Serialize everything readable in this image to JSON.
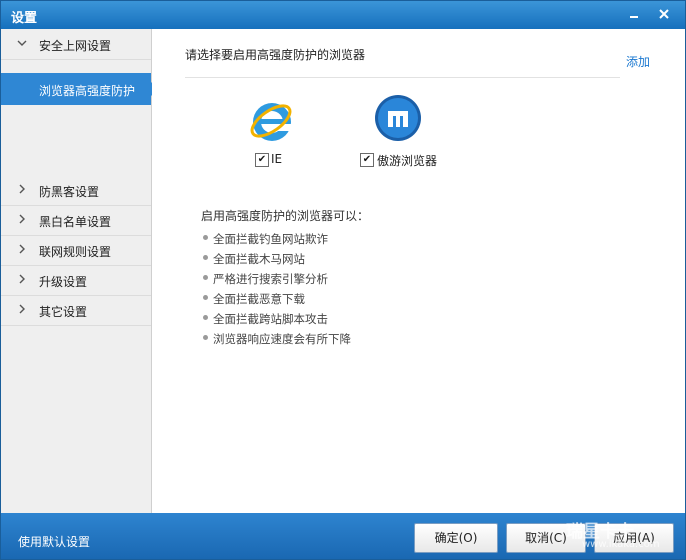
{
  "window": {
    "title": "设置"
  },
  "sidebar": {
    "expanded": {
      "label": "安全上网设置",
      "chevron": "chevron-down-icon"
    },
    "selected_sub": {
      "label": "浏览器高强度防护"
    },
    "items": [
      {
        "label": "防黑客设置"
      },
      {
        "label": "黑白名单设置"
      },
      {
        "label": "联网规则设置"
      },
      {
        "label": "升级设置"
      },
      {
        "label": "其它设置"
      }
    ]
  },
  "content": {
    "heading": "请选择要启用高强度防护的浏览器",
    "add_label": "添加",
    "browsers": [
      {
        "name": "IE",
        "checked": true,
        "icon": "ie-icon"
      },
      {
        "name": "傲游浏览器",
        "checked": true,
        "icon": "maxthon-icon"
      }
    ],
    "features_title": "启用高强度防护的浏览器可以：",
    "features": [
      "全面拦截钓鱼网站欺诈",
      "全面拦截木马网站",
      "严格进行搜索引擎分析",
      "全面拦截恶意下载",
      "全面拦截跨站脚本攻击",
      "浏览器响应速度会有所下降"
    ]
  },
  "footer": {
    "defaults_label": "使用默认设置",
    "ok_label": "确定(O)",
    "cancel_label": "取消(C)",
    "apply_label": "应用(A)"
  },
  "watermark": {
    "text": "瑞星卡卡",
    "url": "www.ikaka.com"
  },
  "colors": {
    "accent": "#2f87d4",
    "link": "#1b78d0",
    "titlebar": "#1670bd"
  }
}
